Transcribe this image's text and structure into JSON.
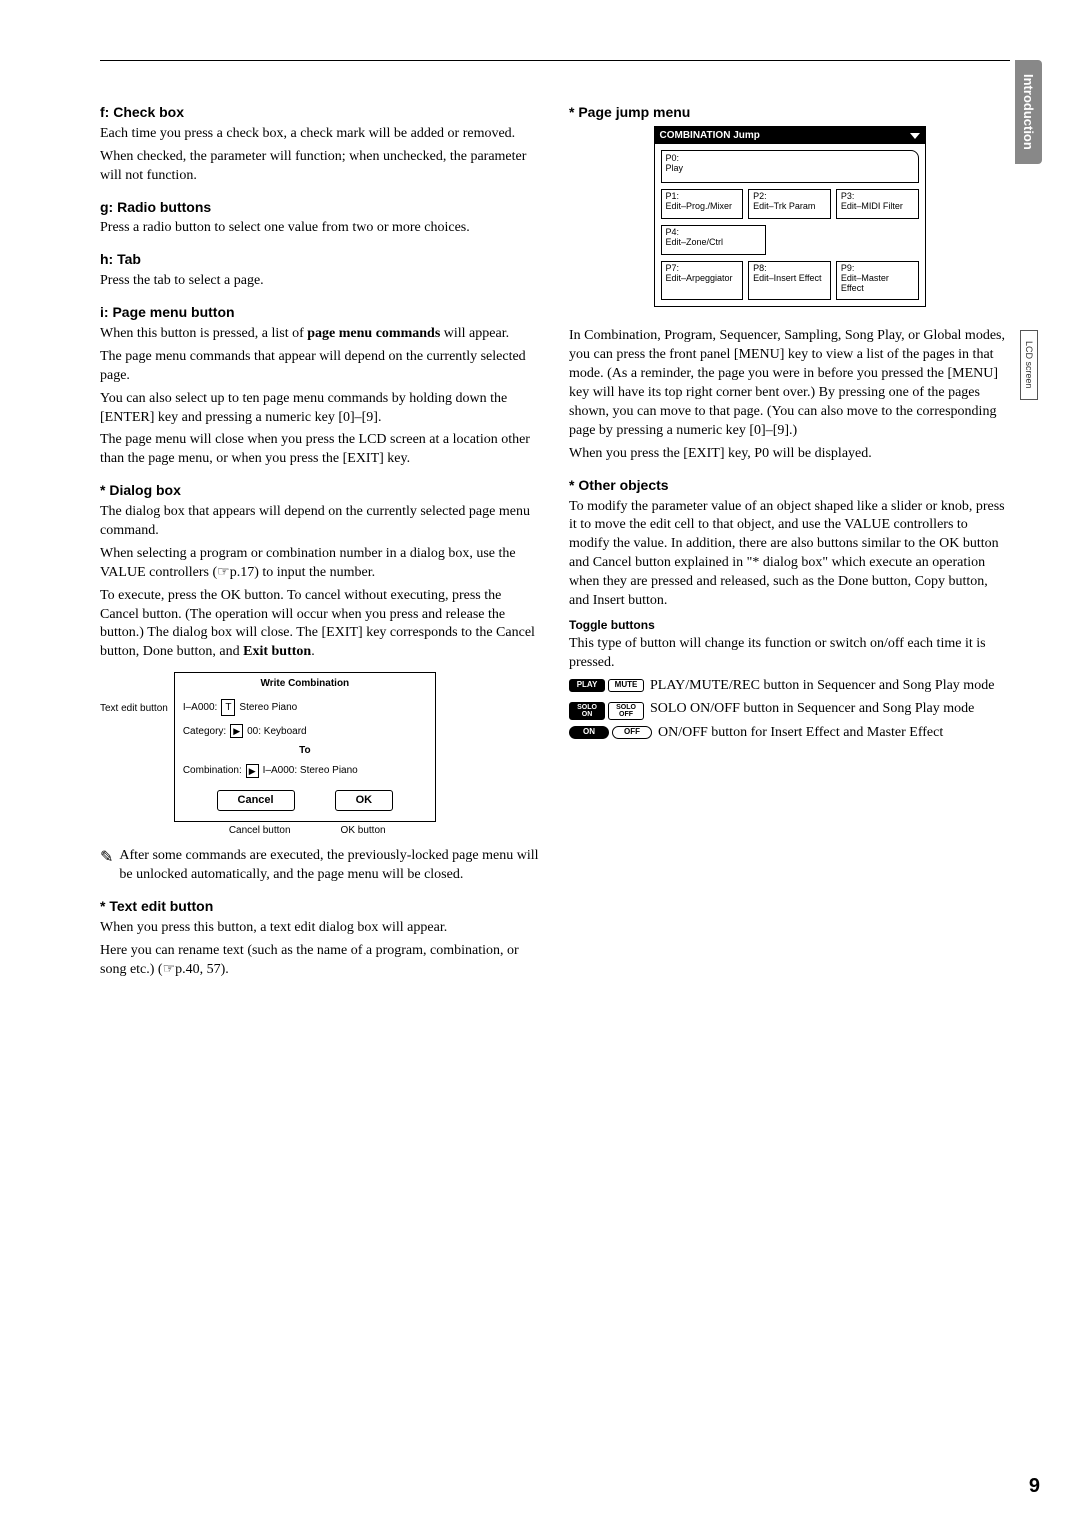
{
  "sideTabs": {
    "intro": "Introduction",
    "lcd": "LCD screen"
  },
  "pageNumber": "9",
  "left": {
    "f": {
      "title": "f: Check box",
      "p1": "Each time you press a check box, a check mark will be added or removed.",
      "p2": "When checked, the parameter will function; when unchecked, the parameter will not function."
    },
    "g": {
      "title": "g: Radio buttons",
      "p1": "Press a radio button to select one value from two or more choices."
    },
    "h": {
      "title": "h: Tab",
      "p1": "Press the tab to select a page."
    },
    "i": {
      "title": "i: Page menu button",
      "p1a": "When this button is pressed, a list of ",
      "p1strong": "page menu commands",
      "p1b": " will appear.",
      "p2": "The page menu commands that appear will depend on the currently selected page.",
      "p3": "You can also select up to ten page menu commands by holding down the [ENTER] key and pressing a numeric key [0]–[9].",
      "p4": "The page menu will close when you press the LCD screen at a location other than the page menu, or when you press the [EXIT] key."
    },
    "dialog": {
      "title": "* Dialog box",
      "p1": "The dialog box that appears will depend on the currently selected page menu command.",
      "p2": "When selecting a program or combination number in a dialog box, use the VALUE controllers (☞p.17) to input the number.",
      "p3a": "To execute, press the OK button. To cancel without executing, press the Cancel button. (The operation will occur when you press and release the button.) The dialog box will close. The [EXIT] key corresponds to the Cancel button, Done button, and ",
      "p3strong": "Exit button",
      "p3b": "."
    },
    "dialogFigure": {
      "leftLabel": "Text edit button",
      "title": "Write Combination",
      "row1prefix": "I–A000:",
      "row1icon": "T",
      "row1text": "Stereo Piano",
      "row2label": "Category:",
      "row2icon": "▶",
      "row2text": "00: Keyboard",
      "toLabel": "To",
      "row3label": "Combination:",
      "row3icon": "▶",
      "row3text": "I–A000: Stereo Piano",
      "cancel": "Cancel",
      "ok": "OK",
      "cancelLabel": "Cancel button",
      "okLabel": "OK button"
    },
    "note": {
      "text": "After some commands are executed, the previously-locked page menu will be unlocked automatically, and the page menu will be closed."
    },
    "textEdit": {
      "title": "* Text edit button",
      "p1": "When you press this button, a text edit dialog box will appear.",
      "p2": "Here you can rename text (such as the name of a program, combination, or song etc.) (☞p.40, 57)."
    }
  },
  "right": {
    "pageJump": {
      "title": "* Page jump menu",
      "header": "COMBINATION Jump",
      "p0a": "P0:",
      "p0b": "Play",
      "row1": {
        "c1a": "P1:",
        "c1b": "Edit–Prog./Mixer",
        "c2a": "P2:",
        "c2b": "Edit–Trk Param",
        "c3a": "P3:",
        "c3b": "Edit–MIDI Filter"
      },
      "row2": {
        "c1a": "P4:",
        "c1b": "Edit–Zone/Ctrl"
      },
      "row3": {
        "c1a": "P7:",
        "c1b": "Edit–Arpeggiator",
        "c2a": "P8:",
        "c2b": "Edit–Insert Effect",
        "c3a": "P9:",
        "c3b": "Edit–Master Effect"
      },
      "body1": "In Combination, Program, Sequencer, Sampling, Song Play, or Global modes, you can press the front panel [MENU] key to view a list of the pages in that mode. (As a reminder, the page you were in before you pressed the [MENU] key will have its top right corner bent over.) By pressing one of the pages shown, you can move to that page. (You can also move to the corresponding page by pressing a numeric key [0]–[9].)",
      "body2": "When you press the [EXIT] key, P0 will be displayed."
    },
    "otherObjects": {
      "title": "* Other objects",
      "p1": "To modify the parameter value of an object shaped like a slider or knob, press it to move the edit cell to that object, and use the VALUE controllers to modify the value. In addition, there are also buttons similar to the OK button and Cancel button explained in \"* dialog box\" which execute an operation when they are pressed and released, such as the Done button, Copy button, and Insert button."
    },
    "toggle": {
      "title": "Toggle buttons",
      "intro": "This type of button will change its function or switch on/off each time it is pressed.",
      "row1": {
        "btnLeft": "PLAY",
        "btnRight": "MUTE",
        "text": "PLAY/MUTE/REC button in Sequencer and Song Play mode"
      },
      "row2": {
        "btnLeftA": "SOLO",
        "btnLeftB": "ON",
        "btnRightA": "SOLO",
        "btnRightB": "OFF",
        "text": "SOLO ON/OFF button in Sequencer and Song Play mode"
      },
      "row3": {
        "btnLeft": "ON",
        "btnRight": "OFF",
        "text": "ON/OFF button for Insert Effect and Master Effect"
      }
    }
  }
}
